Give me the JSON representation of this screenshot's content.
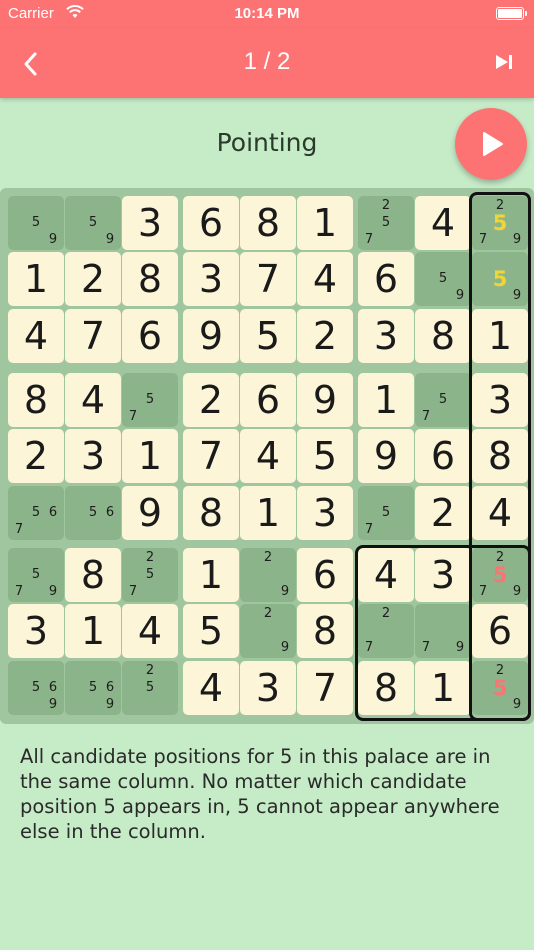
{
  "status_bar": {
    "carrier": "Carrier",
    "time": "10:14 PM"
  },
  "nav": {
    "title": "1 / 2"
  },
  "heading": "Pointing",
  "explanation": "All candidate positions for 5 in this palace are in the same column. No matter which candidate position 5 appears in, 5 cannot appear anywhere else in the column.",
  "colors": {
    "accent": "#fd7373",
    "background": "#c6ebc7",
    "given_cell": "#fcf5d8",
    "empty_cell": "#8cb48a",
    "highlight_candidate": "#f0d534",
    "eliminate_candidate": "#fd7373"
  },
  "grid": [
    [
      {
        "c": [
          5,
          9
        ]
      },
      {
        "c": [
          5,
          9
        ]
      },
      {
        "v": 3
      },
      {
        "v": 6
      },
      {
        "v": 8
      },
      {
        "v": 1
      },
      {
        "c": [
          2,
          5,
          7
        ]
      },
      {
        "v": 4
      },
      {
        "c": [
          2,
          5,
          7,
          9
        ],
        "hl": [
          5
        ]
      }
    ],
    [
      {
        "v": 1
      },
      {
        "v": 2
      },
      {
        "v": 8
      },
      {
        "v": 3
      },
      {
        "v": 7
      },
      {
        "v": 4
      },
      {
        "v": 6
      },
      {
        "c": [
          5,
          9
        ]
      },
      {
        "c": [
          5,
          9
        ],
        "hl": [
          5
        ]
      }
    ],
    [
      {
        "v": 4
      },
      {
        "v": 7
      },
      {
        "v": 6
      },
      {
        "v": 9
      },
      {
        "v": 5
      },
      {
        "v": 2
      },
      {
        "v": 3
      },
      {
        "v": 8
      },
      {
        "v": 1
      }
    ],
    [
      {
        "v": 8
      },
      {
        "v": 4
      },
      {
        "c": [
          5,
          7
        ]
      },
      {
        "v": 2
      },
      {
        "v": 6
      },
      {
        "v": 9
      },
      {
        "v": 1
      },
      {
        "c": [
          5,
          7
        ]
      },
      {
        "v": 3
      }
    ],
    [
      {
        "v": 2
      },
      {
        "v": 3
      },
      {
        "v": 1
      },
      {
        "v": 7
      },
      {
        "v": 4
      },
      {
        "v": 5
      },
      {
        "v": 9
      },
      {
        "v": 6
      },
      {
        "v": 8
      }
    ],
    [
      {
        "c": [
          5,
          6,
          7
        ]
      },
      {
        "c": [
          5,
          6
        ]
      },
      {
        "v": 9
      },
      {
        "v": 8
      },
      {
        "v": 1
      },
      {
        "v": 3
      },
      {
        "c": [
          5,
          7
        ]
      },
      {
        "v": 2
      },
      {
        "v": 4
      }
    ],
    [
      {
        "c": [
          5,
          7,
          9
        ]
      },
      {
        "v": 8
      },
      {
        "c": [
          2,
          5,
          7
        ]
      },
      {
        "v": 1
      },
      {
        "c": [
          2,
          9
        ]
      },
      {
        "v": 6
      },
      {
        "v": 4
      },
      {
        "v": 3
      },
      {
        "c": [
          2,
          5,
          7,
          9
        ],
        "el": [
          5
        ]
      }
    ],
    [
      {
        "v": 3
      },
      {
        "v": 1
      },
      {
        "v": 4
      },
      {
        "v": 5
      },
      {
        "c": [
          2,
          9
        ]
      },
      {
        "v": 8
      },
      {
        "c": [
          2,
          7
        ]
      },
      {
        "c": [
          7,
          9
        ]
      },
      {
        "v": 6
      }
    ],
    [
      {
        "c": [
          5,
          6,
          9
        ]
      },
      {
        "c": [
          5,
          6,
          9
        ]
      },
      {
        "c": [
          2,
          5
        ]
      },
      {
        "v": 4
      },
      {
        "v": 3
      },
      {
        "v": 7
      },
      {
        "v": 8
      },
      {
        "v": 1
      },
      {
        "c": [
          2,
          5,
          9
        ],
        "el": [
          5
        ]
      }
    ]
  ]
}
